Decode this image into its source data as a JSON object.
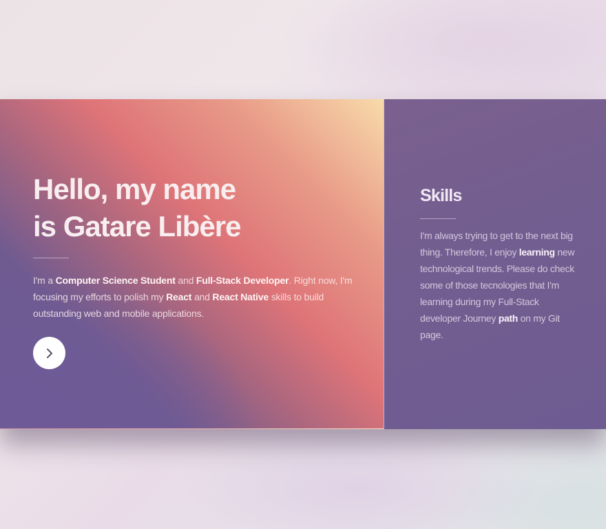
{
  "hero": {
    "title_line1": "Hello, my name",
    "title_line2": "is Gatare Libère",
    "bio": [
      {
        "text": "I'm a ",
        "bold": false
      },
      {
        "text": "Computer Science Student",
        "bold": true
      },
      {
        "text": " and ",
        "bold": false
      },
      {
        "text": "Full-Stack Developer",
        "bold": true
      },
      {
        "text": ". Right now, I'm focusing my efforts to polish my ",
        "bold": false
      },
      {
        "text": "React",
        "bold": true
      },
      {
        "text": " and ",
        "bold": false
      },
      {
        "text": "React Native",
        "bold": true
      },
      {
        "text": " skills to build outstanding web and mobile applications.",
        "bold": false
      }
    ],
    "next_button_icon": "chevron-right-icon",
    "next_button_icon_color": "#5a4f66"
  },
  "skills": {
    "title": "Skills",
    "text": [
      {
        "text": "I'm always trying to get to the next big thing. Therefore, I enjoy ",
        "bold": false
      },
      {
        "text": "learning",
        "bold": true
      },
      {
        "text": " new technological trends. Please do check some of those tecnologies that I'm learning during my Full-Stack developer Journey ",
        "bold": false
      },
      {
        "text": "path",
        "bold": true
      },
      {
        "text": " on my Git page.",
        "bold": false
      }
    ]
  },
  "colors": {
    "hero_gradient": [
      "#6e5a92",
      "#de7478",
      "#f8dbaa"
    ],
    "skills_panel": "#735e90",
    "button": "#ffffff"
  }
}
